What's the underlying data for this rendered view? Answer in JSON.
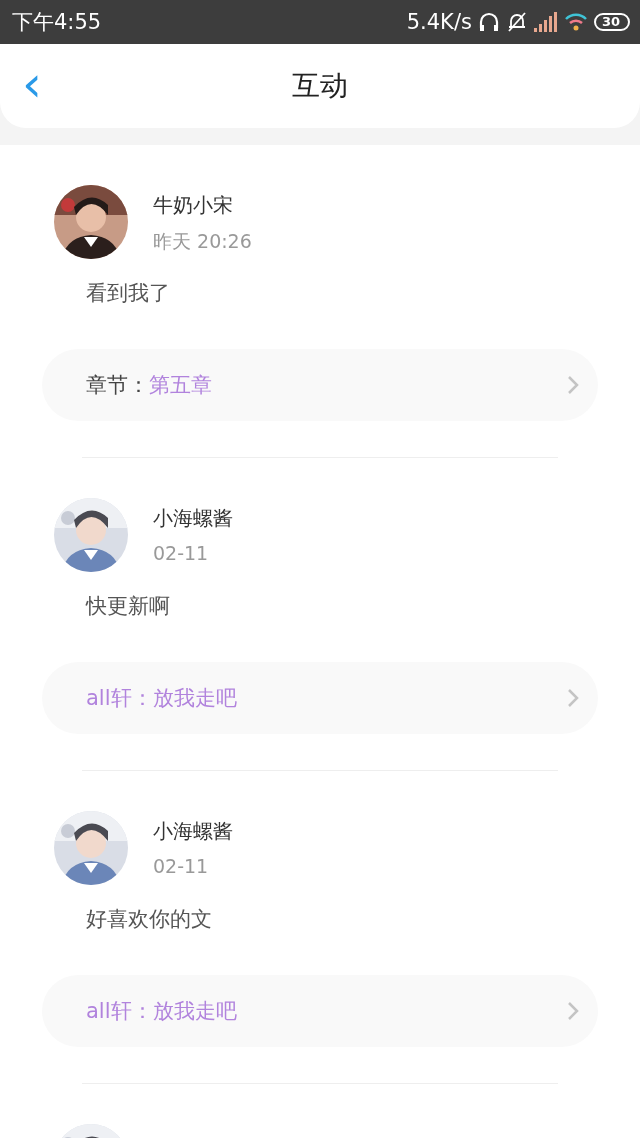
{
  "status_bar": {
    "time": "下午4:55",
    "speed": "5.4K/s",
    "battery": "30"
  },
  "header": {
    "back": "‹",
    "title": "互动"
  },
  "comments": [
    {
      "author": "牛奶小宋",
      "time": "昨天 20:26",
      "text": "看到我了",
      "link": [
        {
          "text": "章节：",
          "highlighted": false
        },
        {
          "text": "第五章",
          "highlighted": true
        }
      ]
    },
    {
      "author": "小海螺酱",
      "time": "02-11",
      "text": "快更新啊",
      "link": [
        {
          "text": "all轩：放我走吧",
          "highlighted": true
        }
      ]
    },
    {
      "author": "小海螺酱",
      "time": "02-11",
      "text": "好喜欢你的文",
      "link": [
        {
          "text": "all轩：放我走吧",
          "highlighted": true
        }
      ]
    }
  ]
}
